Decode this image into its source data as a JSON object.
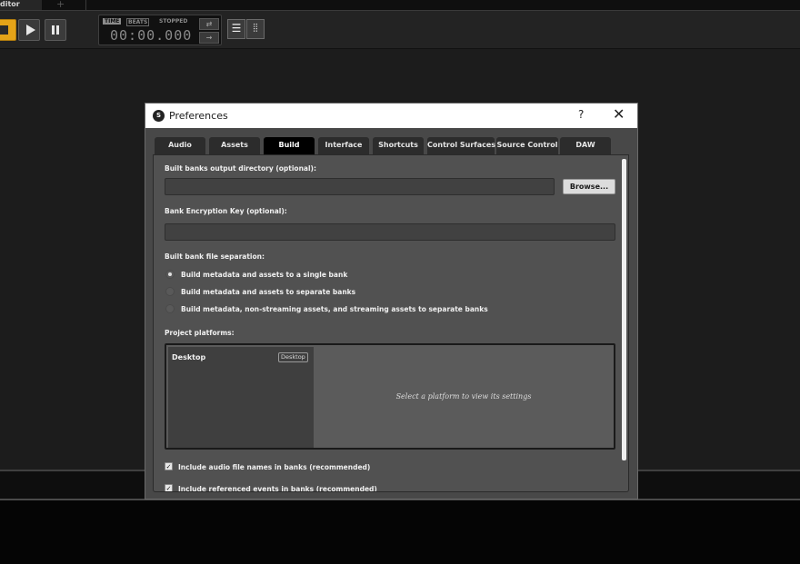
{
  "app": {
    "tab_label": "ditor",
    "add_tab": "+",
    "transport": {
      "time_label": "TIME",
      "beats_label": "BEATS",
      "status": "STOPPED",
      "time_display": "00:00.000"
    },
    "icons": {
      "stop": "stop-icon",
      "play": "play-icon",
      "pause": "pause-icon",
      "list": "list-icon",
      "grid": "grid-icon",
      "app_logo": "fmod-logo-icon"
    },
    "accent_color": "#e5a418"
  },
  "dialog": {
    "title": "Preferences",
    "help": "?",
    "close": "✕",
    "tabs": [
      {
        "label": "Audio"
      },
      {
        "label": "Assets"
      },
      {
        "label": "Build"
      },
      {
        "label": "Interface"
      },
      {
        "label": "Shortcuts"
      },
      {
        "label": "Control Surfaces"
      },
      {
        "label": "Source Control"
      },
      {
        "label": "DAW"
      }
    ],
    "active_tab": "Build",
    "build": {
      "output_dir_label": "Built banks output directory (optional):",
      "output_dir_value": "",
      "browse_label": "Browse...",
      "encryption_label": "Bank Encryption Key (optional):",
      "encryption_value": "",
      "separation_label": "Built bank file separation:",
      "separation_options": [
        {
          "label": "Build metadata and assets to a single bank",
          "checked": true
        },
        {
          "label": "Build metadata and assets to separate banks",
          "checked": false
        },
        {
          "label": "Build metadata, non-streaming assets, and streaming assets to separate banks",
          "checked": false
        }
      ],
      "platforms_label": "Project platforms:",
      "platform_name": "Desktop",
      "platform_badge": "Desktop",
      "platform_hint": "Select a platform to view its settings",
      "checkboxes": [
        {
          "label": "Include audio file names in banks (recommended)",
          "checked": true
        },
        {
          "label": "Include referenced events in banks (recommended)",
          "checked": true
        }
      ]
    }
  }
}
